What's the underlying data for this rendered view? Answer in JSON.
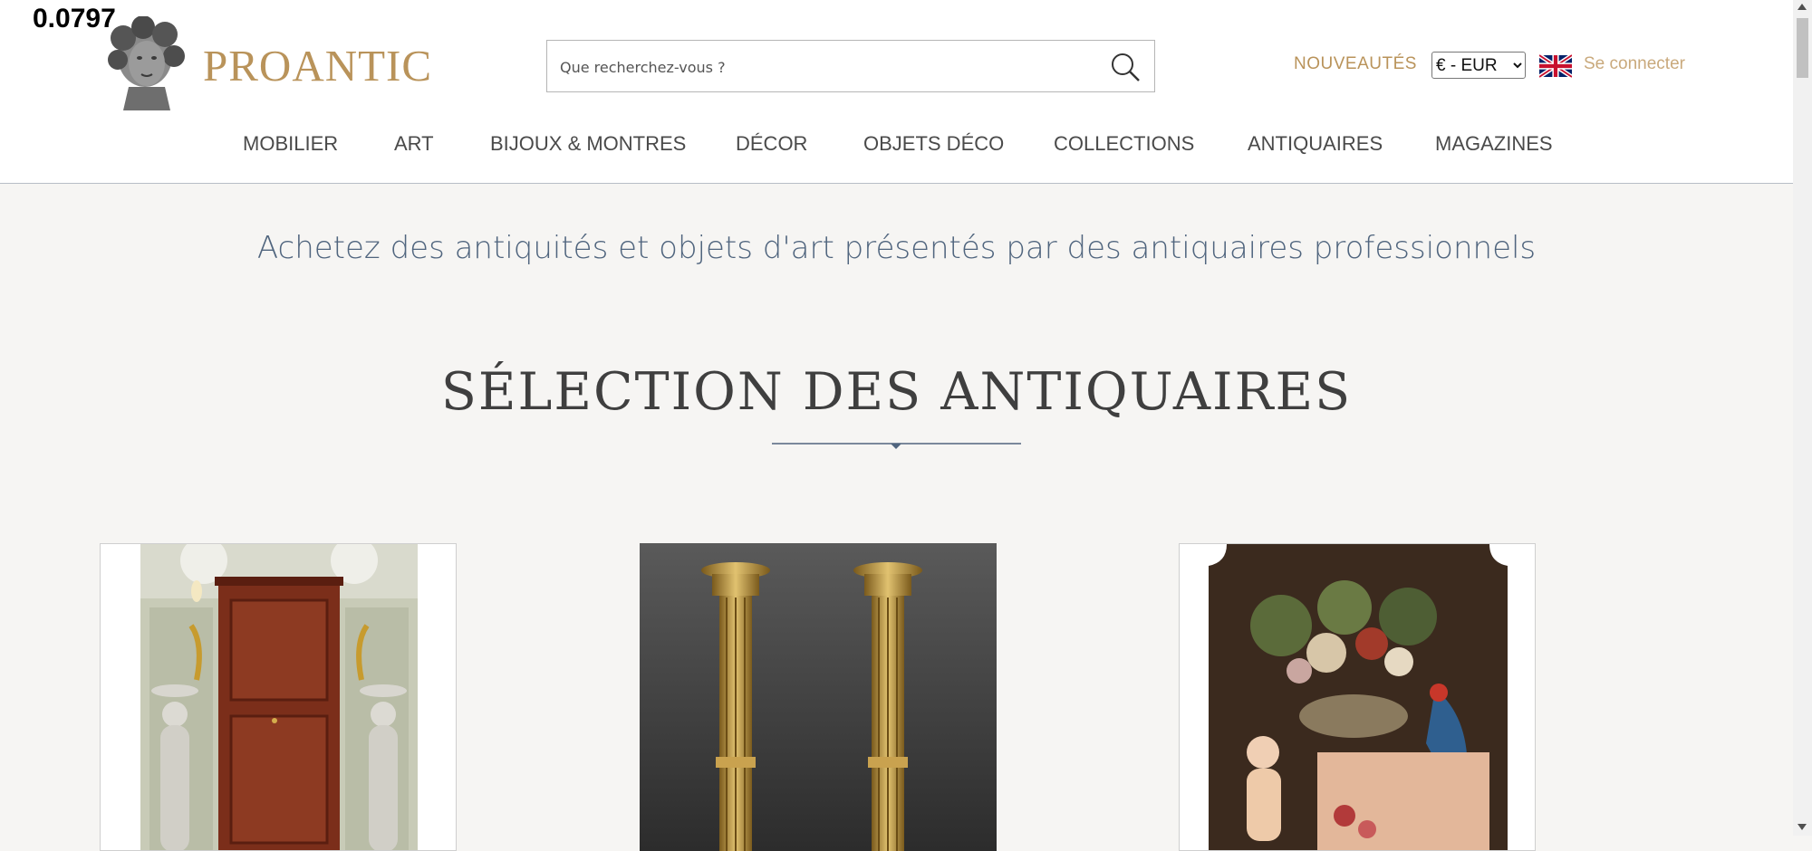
{
  "overlay": {
    "value": "0.0797"
  },
  "header": {
    "logo_text": "PROANTIC",
    "search": {
      "placeholder": "Que recherchez-vous ?",
      "value": ""
    },
    "nouveautes_label": "NOUVEAUTÉS",
    "currency": {
      "selected": "€ - EUR"
    },
    "language_flag": "uk-flag-icon",
    "login_label": "Se connecter",
    "colors": {
      "brand_gold": "#b9935a",
      "login_gold": "#c9a97c"
    }
  },
  "nav": {
    "items": [
      {
        "label": "MOBILIER"
      },
      {
        "label": "ART"
      },
      {
        "label": "BIJOUX & MONTRES"
      },
      {
        "label": "DÉCOR"
      },
      {
        "label": "OBJETS DÉCO"
      },
      {
        "label": "COLLECTIONS"
      },
      {
        "label": "ANTIQUAIRES"
      },
      {
        "label": "MAGAZINES"
      }
    ]
  },
  "main": {
    "tagline": "Achetez des antiquités et objets d'art présentés par des antiquaires professionnels",
    "section_title": "SÉLECTION DES ANTIQUAIRES",
    "products": [
      {
        "image": "mahogany-cabinet-with-cherub-statues"
      },
      {
        "image": "pair-of-gilt-bronze-candlesticks"
      },
      {
        "image": "floral-still-life-with-parrot-painting"
      }
    ]
  }
}
